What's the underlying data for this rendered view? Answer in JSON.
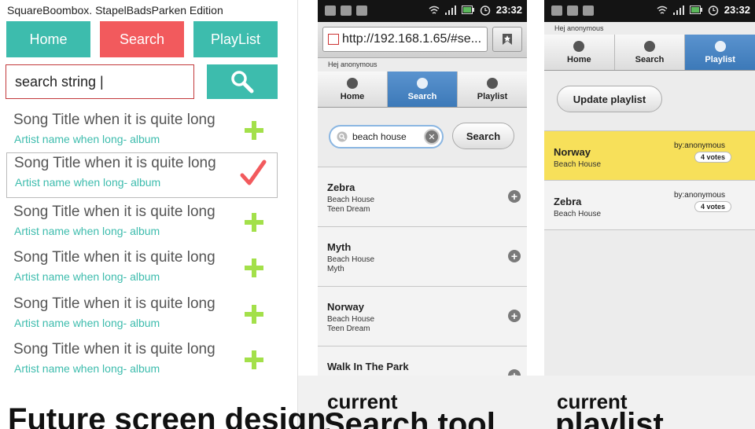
{
  "future_design": {
    "app_title": "SquareBoombox. StapelBadsParken Edition",
    "nav": [
      "Home",
      "Search",
      "PlayList"
    ],
    "search_value": "search string |",
    "songs": [
      {
        "title": "Song Title when it is quite long",
        "artist": "Artist name when long- album",
        "action": "plus-icon"
      },
      {
        "title": "Song Title when it is quite long",
        "artist": "Artist name when long- album",
        "action": "checkmark-icon"
      },
      {
        "title": "Song Title when it is quite long",
        "artist": "Artist name when long- album",
        "action": "plus-icon"
      },
      {
        "title": "Song Title when it is quite long",
        "artist": "Artist name when long- album",
        "action": "plus-icon"
      },
      {
        "title": "Song Title when it is quite long",
        "artist": "Artist name when long- album",
        "action": "plus-icon"
      },
      {
        "title": "Song Title when it is quite long",
        "artist": "Artist name when long- album",
        "action": "plus-icon"
      }
    ],
    "caption": "Future screen design",
    "colors": {
      "teal": "#3dbcad",
      "red": "#f25a5d",
      "plus_green": "#a3e04a"
    }
  },
  "search_tool": {
    "status_time": "23:32",
    "url": "http://192.168.1.65/#se...",
    "greeting": "Hej anonymous",
    "tabs": [
      "Home",
      "Search",
      "Playlist"
    ],
    "search_value": "beach house",
    "search_button": "Search",
    "results": [
      {
        "title": "Zebra",
        "line1": "Beach House",
        "line2": "Teen Dream"
      },
      {
        "title": "Myth",
        "line1": "Beach House",
        "line2": "Myth"
      },
      {
        "title": "Norway",
        "line1": "Beach House",
        "line2": "Teen Dream"
      },
      {
        "title": "Walk In The Park",
        "line1": "",
        "line2": ""
      }
    ],
    "caption_small": "current",
    "caption_big": "Search tool"
  },
  "playlist": {
    "status_time": "23:32",
    "greeting": "Hej anonymous",
    "tabs": [
      "Home",
      "Search",
      "Playlist"
    ],
    "update_button": "Update playlist",
    "items": [
      {
        "title": "Norway",
        "artist": "Beach House",
        "by": "by:anonymous",
        "votes": "4 votes"
      },
      {
        "title": "Zebra",
        "artist": "Beach House",
        "by": "by:anonymous",
        "votes": "4 votes"
      }
    ],
    "caption_small": "current",
    "caption_big": "playlist",
    "colors": {
      "now_playing": "#f7e05a",
      "active_tab": "#4a87c6"
    }
  }
}
